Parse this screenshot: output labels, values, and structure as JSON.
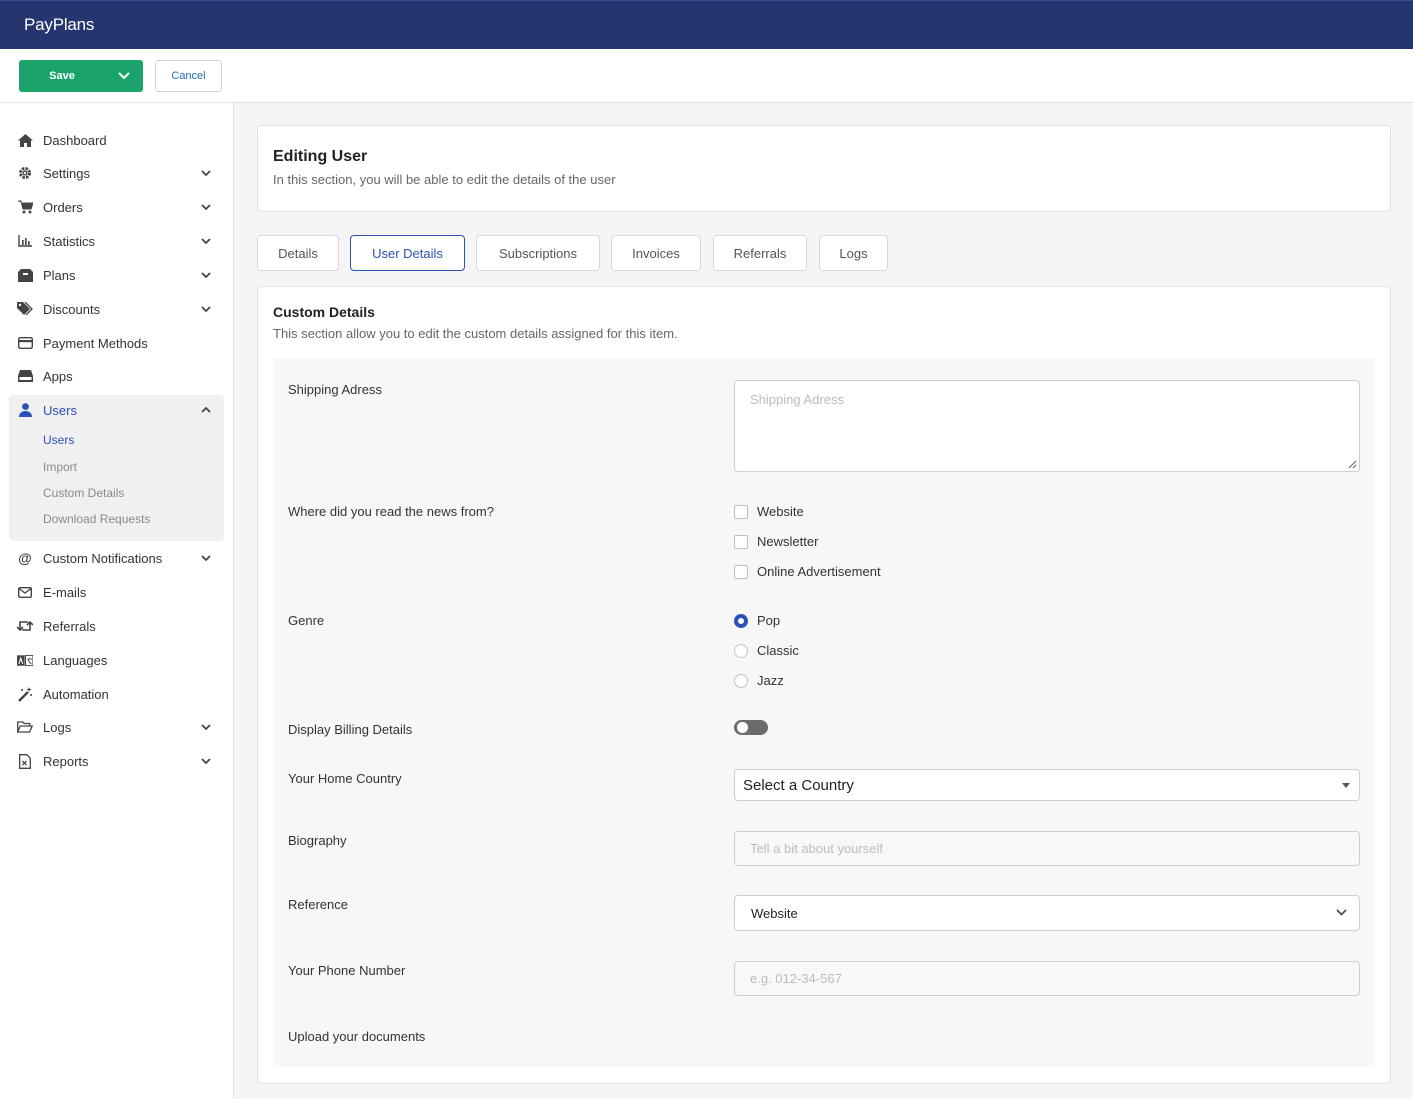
{
  "app": {
    "title": "PayPlans"
  },
  "toolbar": {
    "save_label": "Save",
    "cancel_label": "Cancel"
  },
  "sidebar": {
    "items": [
      {
        "label": "Dashboard",
        "icon": "home-icon"
      },
      {
        "label": "Settings",
        "icon": "gear-icon"
      },
      {
        "label": "Orders",
        "icon": "cart-icon"
      },
      {
        "label": "Statistics",
        "icon": "bar-chart-icon"
      },
      {
        "label": "Plans",
        "icon": "box-icon"
      },
      {
        "label": "Discounts",
        "icon": "tags-icon"
      },
      {
        "label": "Payment Methods",
        "icon": "credit-card-icon"
      },
      {
        "label": "Apps",
        "icon": "drive-icon"
      },
      {
        "label": "Users",
        "icon": "user-icon"
      },
      {
        "label": "Custom Notifications",
        "icon": "at-icon"
      },
      {
        "label": "E-mails",
        "icon": "envelope-icon"
      },
      {
        "label": "Referrals",
        "icon": "retweet-icon"
      },
      {
        "label": "Languages",
        "icon": "language-icon"
      },
      {
        "label": "Automation",
        "icon": "magic-wand-icon"
      },
      {
        "label": "Logs",
        "icon": "folder-open-icon"
      },
      {
        "label": "Reports",
        "icon": "file-excel-icon"
      }
    ],
    "users_sub": [
      "Users",
      "Import",
      "Custom Details",
      "Download Requests"
    ]
  },
  "header": {
    "title": "Editing User",
    "subtitle": "In this section, you will be able to edit the details of the user"
  },
  "tabs": [
    "Details",
    "User Details",
    "Subscriptions",
    "Invoices",
    "Referrals",
    "Logs"
  ],
  "active_tab": "User Details",
  "custom": {
    "title": "Custom Details",
    "subtitle": "This section allow you to edit the custom details assigned for this item.",
    "shipping": {
      "label": "Shipping Adress",
      "placeholder": "Shipping Adress"
    },
    "news": {
      "label": "Where did you read the news from?",
      "options": [
        "Website",
        "Newsletter",
        "Online Advertisement"
      ]
    },
    "genre": {
      "label": "Genre",
      "options": [
        "Pop",
        "Classic",
        "Jazz"
      ],
      "selected": "Pop"
    },
    "billing": {
      "label": "Display Billing Details",
      "enabled": false
    },
    "country": {
      "label": "Your Home Country",
      "value": "Select a Country"
    },
    "biography": {
      "label": "Biography",
      "placeholder": "Tell a bit about yourself"
    },
    "reference": {
      "label": "Reference",
      "value": "Website"
    },
    "phone": {
      "label": "Your Phone Number",
      "placeholder": "e.g. 012-34-567"
    },
    "upload": {
      "label": "Upload your documents"
    }
  },
  "colors": {
    "topbar": "#25356f",
    "save": "#1aa36a",
    "accent": "#2c52b8"
  }
}
